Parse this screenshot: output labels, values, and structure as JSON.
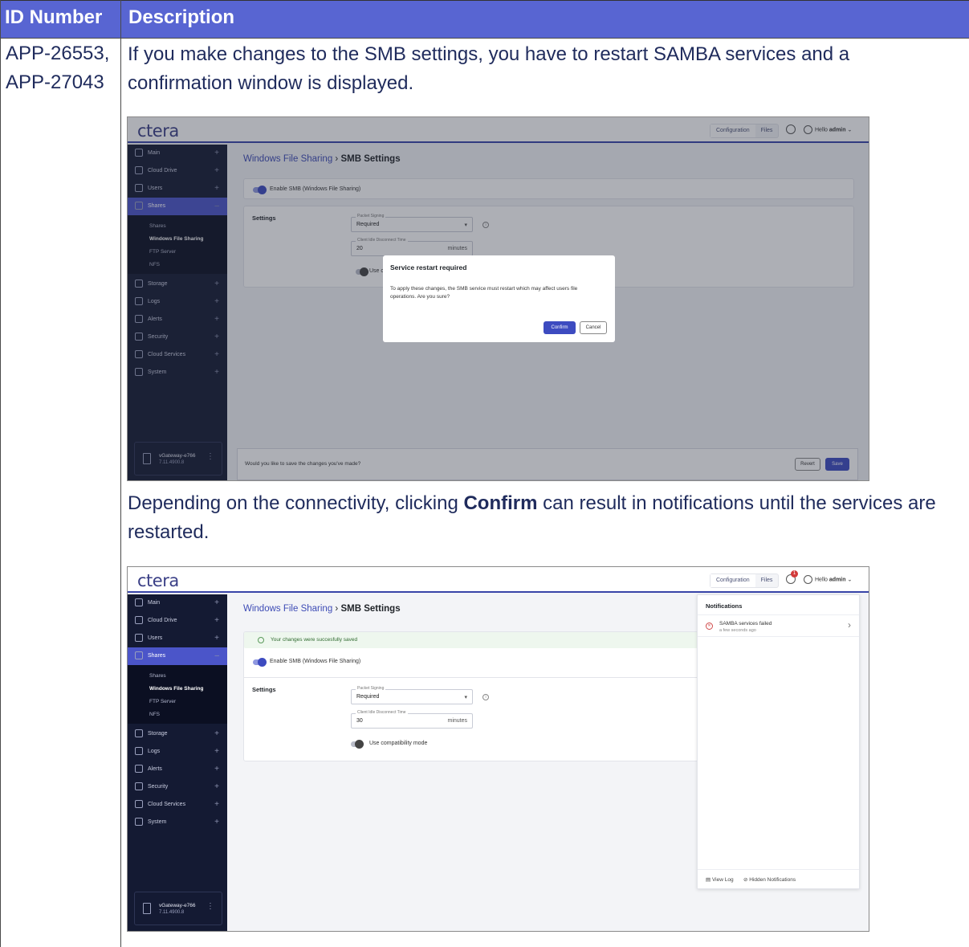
{
  "table": {
    "headers": [
      "ID Number",
      "Description"
    ],
    "ids": [
      "APP-26553,",
      "APP-27043"
    ],
    "para1": "If you make changes to the SMB settings, you have to restart SAMBA services and a confirmation window is displayed.",
    "para2_pre": "Depending on the connectivity, clicking ",
    "para2_bold": "Confirm",
    "para2_post": " can result in notifications until the services are restarted."
  },
  "app": {
    "logo": "ctera",
    "tabs": [
      "Configuration",
      "Files"
    ],
    "greeting": "Hello",
    "username": "admin",
    "notif_count": "1",
    "nav": [
      "Main",
      "Cloud Drive",
      "Users",
      "Shares",
      "Storage",
      "Logs",
      "Alerts",
      "Security",
      "Cloud Services",
      "System"
    ],
    "subnav": [
      "Shares",
      "Windows File Sharing",
      "FTP Server",
      "NFS"
    ],
    "device_name": "vGateway-e766",
    "device_version": "7.11.4900.8",
    "breadcrumb_link": "Windows File Sharing",
    "breadcrumb_sep": "›",
    "breadcrumb_page": "SMB Settings",
    "enable_smb": "Enable SMB (Windows File Sharing)",
    "settings_label": "Settings",
    "packet_signing_label": "Packet Signing",
    "packet_signing_value": "Required",
    "idle_label": "Client Idle Disconnect Time",
    "idle_unit": "minutes",
    "compat_label": "Use compatibility mode",
    "compat_cut": "Use c",
    "save_prompt": "Would you like to save the changes you've made?",
    "revert_label": "Revert",
    "save_label": "Save",
    "success_msg": "Your changes were succesfully saved"
  },
  "screen1": {
    "idle_value": "20"
  },
  "screen2": {
    "idle_value": "30"
  },
  "modal": {
    "title": "Service restart required",
    "body": "To apply these changes, the SMB service must restart which may affect users file operations. Are you sure?",
    "confirm": "Confirm",
    "cancel": "Cancel"
  },
  "notifications": {
    "title": "Notifications",
    "item_title": "SAMBA services failed",
    "item_time": "a few seconds ago",
    "view_log": "View Log",
    "hidden": "Hidden Notifications"
  },
  "colors": {
    "header_bg": "#5865d2",
    "accent": "#3d4bc0",
    "sidebar": "#141a33"
  }
}
